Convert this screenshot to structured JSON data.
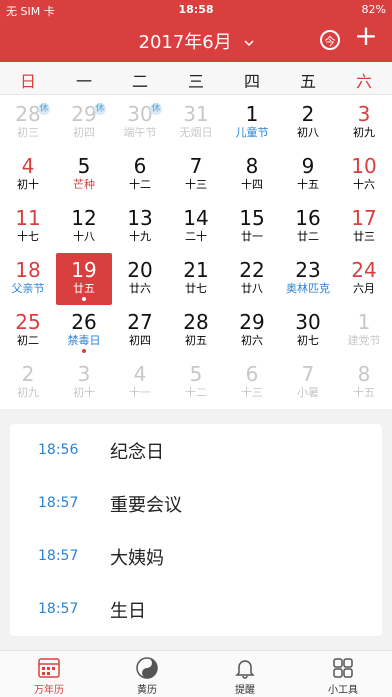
{
  "status": {
    "carrier": "无 SIM 卡",
    "time": "18:58",
    "battery": "82%"
  },
  "header": {
    "title": "2017年6月",
    "today_button": "今",
    "add_button": "+"
  },
  "weekdays": [
    "日",
    "一",
    "二",
    "三",
    "四",
    "五",
    "六"
  ],
  "calendar": {
    "rows": [
      [
        {
          "day": "28",
          "sub": "初三",
          "style": "muted",
          "badge": "休"
        },
        {
          "day": "29",
          "sub": "初四",
          "style": "muted",
          "badge": "休"
        },
        {
          "day": "30",
          "sub": "端午节",
          "style": "muted",
          "sub_color": "muted",
          "badge": "休"
        },
        {
          "day": "31",
          "sub": "无烟日",
          "style": "muted",
          "sub_color": "muted"
        },
        {
          "day": "1",
          "sub": "儿童节",
          "style": "black",
          "sub_color": "blue"
        },
        {
          "day": "2",
          "sub": "初八",
          "style": "black"
        },
        {
          "day": "3",
          "sub": "初九",
          "style": "weekend"
        }
      ],
      [
        {
          "day": "4",
          "sub": "初十",
          "style": "weekend"
        },
        {
          "day": "5",
          "sub": "芒种",
          "style": "black",
          "sub_color": "red"
        },
        {
          "day": "6",
          "sub": "十二",
          "style": "black"
        },
        {
          "day": "7",
          "sub": "十三",
          "style": "black"
        },
        {
          "day": "8",
          "sub": "十四",
          "style": "black"
        },
        {
          "day": "9",
          "sub": "十五",
          "style": "black"
        },
        {
          "day": "10",
          "sub": "十六",
          "style": "weekend"
        }
      ],
      [
        {
          "day": "11",
          "sub": "十七",
          "style": "weekend"
        },
        {
          "day": "12",
          "sub": "十八",
          "style": "black"
        },
        {
          "day": "13",
          "sub": "十九",
          "style": "black"
        },
        {
          "day": "14",
          "sub": "二十",
          "style": "black"
        },
        {
          "day": "15",
          "sub": "廿一",
          "style": "black"
        },
        {
          "day": "16",
          "sub": "廿二",
          "style": "black"
        },
        {
          "day": "17",
          "sub": "廿三",
          "style": "weekend"
        }
      ],
      [
        {
          "day": "18",
          "sub": "父亲节",
          "style": "weekend",
          "sub_color": "blue"
        },
        {
          "day": "19",
          "sub": "廿五",
          "style": "today",
          "dot": true
        },
        {
          "day": "20",
          "sub": "廿六",
          "style": "black"
        },
        {
          "day": "21",
          "sub": "廿七",
          "style": "black"
        },
        {
          "day": "22",
          "sub": "廿八",
          "style": "black"
        },
        {
          "day": "23",
          "sub": "奥林匹克",
          "style": "black",
          "sub_color": "blue"
        },
        {
          "day": "24",
          "sub": "六月",
          "style": "weekend"
        }
      ],
      [
        {
          "day": "25",
          "sub": "初二",
          "style": "weekend"
        },
        {
          "day": "26",
          "sub": "禁毒日",
          "style": "black",
          "sub_color": "blue",
          "dot": true
        },
        {
          "day": "27",
          "sub": "初四",
          "style": "black"
        },
        {
          "day": "28",
          "sub": "初五",
          "style": "black"
        },
        {
          "day": "29",
          "sub": "初六",
          "style": "black"
        },
        {
          "day": "30",
          "sub": "初七",
          "style": "black"
        },
        {
          "day": "1",
          "sub": "建党节",
          "style": "muted",
          "sub_color": "muted"
        }
      ],
      [
        {
          "day": "2",
          "sub": "初九",
          "style": "muted"
        },
        {
          "day": "3",
          "sub": "初十",
          "style": "muted"
        },
        {
          "day": "4",
          "sub": "十一",
          "style": "muted"
        },
        {
          "day": "5",
          "sub": "十二",
          "style": "muted"
        },
        {
          "day": "6",
          "sub": "十三",
          "style": "muted"
        },
        {
          "day": "7",
          "sub": "小暑",
          "style": "muted",
          "sub_color": "muted"
        },
        {
          "day": "8",
          "sub": "十五",
          "style": "muted"
        }
      ]
    ]
  },
  "events": [
    {
      "time": "18:56",
      "label": "纪念日"
    },
    {
      "time": "18:57",
      "label": "重要会议"
    },
    {
      "time": "18:57",
      "label": "大姨妈"
    },
    {
      "time": "18:57",
      "label": "生日"
    }
  ],
  "tabs": [
    {
      "label": "万年历",
      "icon": "calendar-icon",
      "active": true
    },
    {
      "label": "黄历",
      "icon": "yin-yang-icon",
      "active": false
    },
    {
      "label": "提醒",
      "icon": "bell-icon",
      "active": false
    },
    {
      "label": "小工具",
      "icon": "grid-icon",
      "active": false
    }
  ],
  "colors": {
    "brand_red": "#d93f3f",
    "blue": "#2a83d5"
  }
}
